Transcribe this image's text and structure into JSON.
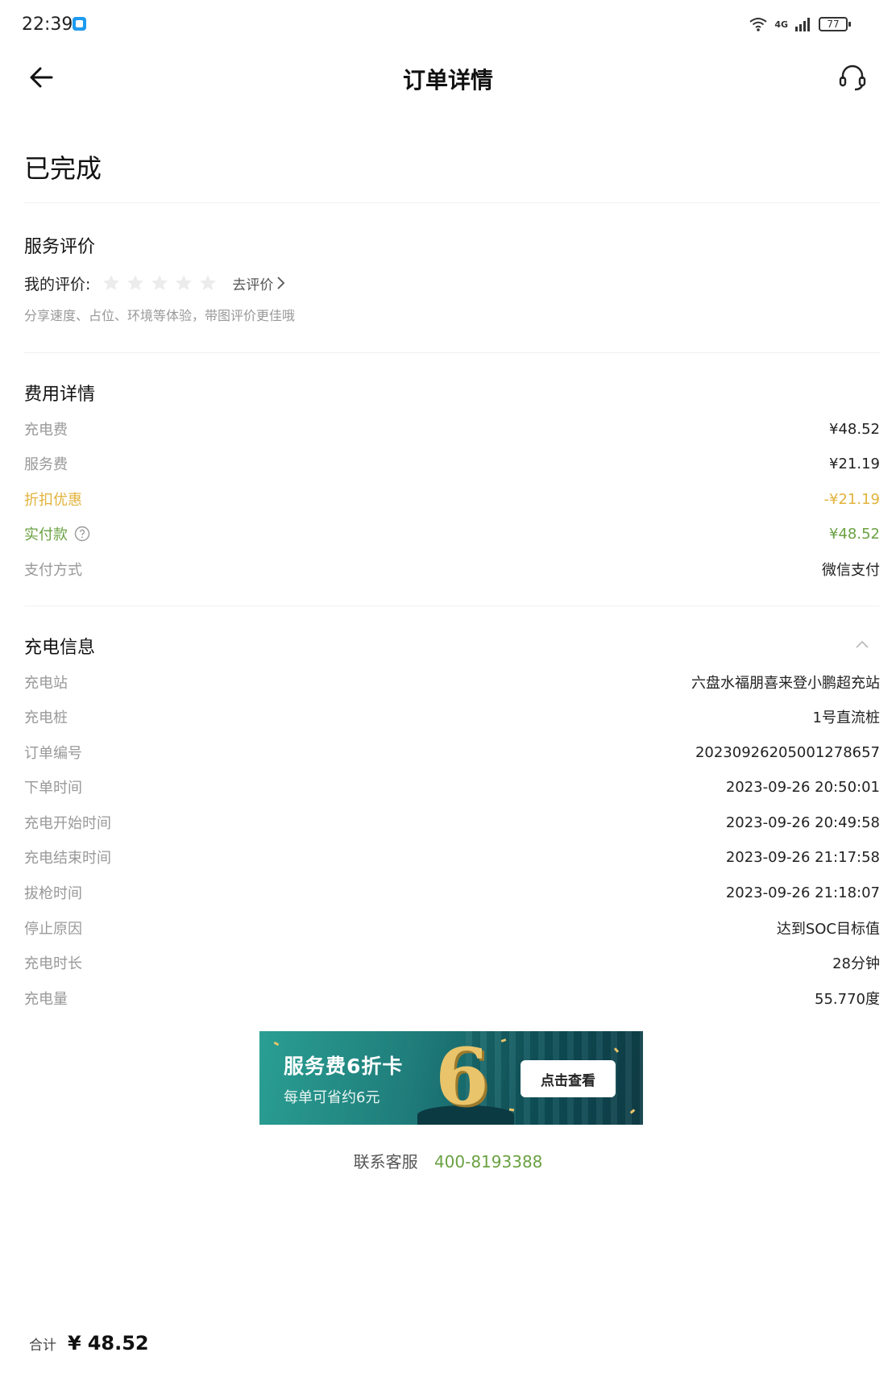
{
  "status_bar": {
    "time": "22:39",
    "network": "4G",
    "battery": "77"
  },
  "nav": {
    "title": "订单详情"
  },
  "order": {
    "status": "已完成"
  },
  "review": {
    "title": "服务评价",
    "my_rating_label": "我的评价:",
    "stars_filled": 0,
    "stars_total": 5,
    "go_rate": "去评价",
    "hint": "分享速度、占位、环境等体验，带图评价更佳哦"
  },
  "fees": {
    "title": "费用详情",
    "rows": [
      {
        "label": "充电费",
        "value": "¥48.52"
      },
      {
        "label": "服务费",
        "value": "¥21.19"
      },
      {
        "label": "折扣优惠",
        "value": "-¥21.19"
      },
      {
        "label": "实付款",
        "value": "¥48.52"
      },
      {
        "label": "支付方式",
        "value": "微信支付"
      }
    ]
  },
  "charging": {
    "title": "充电信息",
    "rows": [
      {
        "label": "充电站",
        "value": "六盘水福朋喜来登小鹏超充站"
      },
      {
        "label": "充电桩",
        "value": "1号直流桩"
      },
      {
        "label": "订单编号",
        "value": "20230926205001278657"
      },
      {
        "label": "下单时间",
        "value": "2023-09-26 20:50:01"
      },
      {
        "label": "充电开始时间",
        "value": "2023-09-26 20:49:58"
      },
      {
        "label": "充电结束时间",
        "value": "2023-09-26 21:17:58"
      },
      {
        "label": "拔枪时间",
        "value": "2023-09-26 21:18:07"
      },
      {
        "label": "停止原因",
        "value": "达到SOC目标值"
      },
      {
        "label": "充电时长",
        "value": "28分钟"
      },
      {
        "label": "充电量",
        "value": "55.770度"
      }
    ]
  },
  "banner": {
    "title": "服务费6折卡",
    "subtitle": "每单可省约6元",
    "big_number": "6",
    "button": "点击查看"
  },
  "contact": {
    "label": "联系客服",
    "phone": "400-8193388"
  },
  "total": {
    "label": "合计",
    "currency": "¥",
    "amount": "48.52"
  },
  "colors": {
    "discount": "#e2b33c",
    "paid": "#6aa142",
    "muted": "#999999"
  }
}
